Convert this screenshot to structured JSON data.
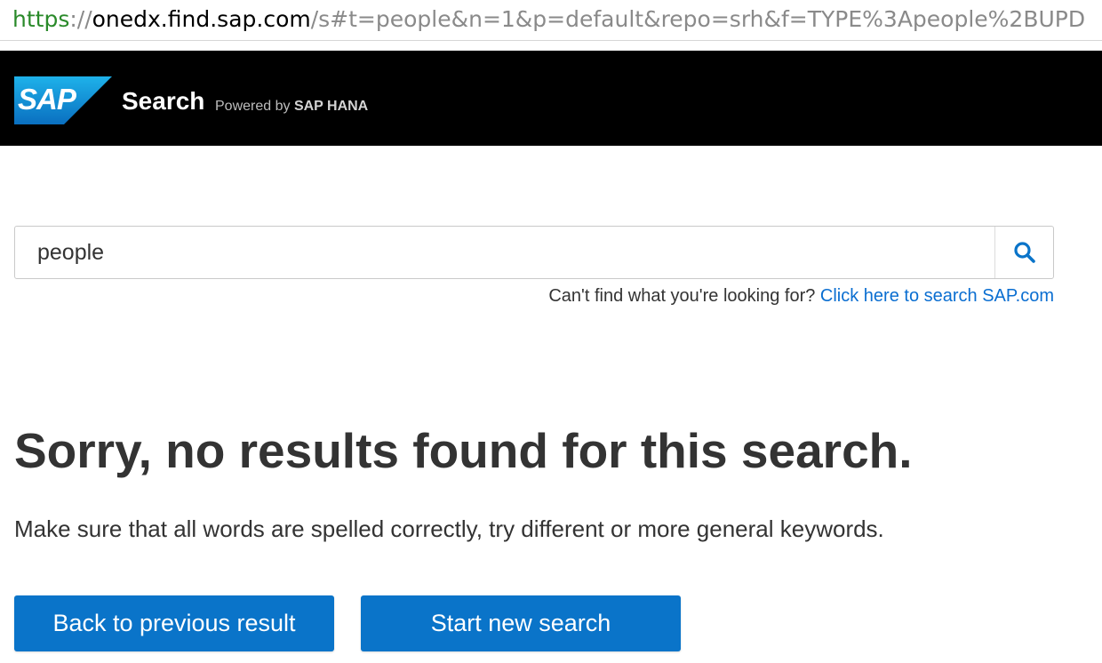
{
  "browser": {
    "url_scheme": "https",
    "url_sep": "://",
    "url_host": "onedx.find.sap.com",
    "url_path": "/s#t=people&n=1&p=default&repo=srh&f=TYPE%3Apeople%2BUPD"
  },
  "header": {
    "logo_text": "SAP",
    "title": "Search",
    "powered_prefix": "Powered by",
    "powered_brand": "SAP HANA"
  },
  "search": {
    "value": "people",
    "button_icon": "search-icon",
    "help_text": "Can't find what you're looking for?",
    "help_link": "Click here to search SAP.com"
  },
  "message": {
    "title": "Sorry, no results found for this search.",
    "hint": "Make sure that all words are spelled correctly, try different or more general keywords."
  },
  "actions": {
    "back_label": "Back to previous result",
    "new_label": "Start new search"
  },
  "colors": {
    "brand_blue": "#0a74c9",
    "link_blue": "#0a6ed1",
    "header_bg": "#000000"
  }
}
